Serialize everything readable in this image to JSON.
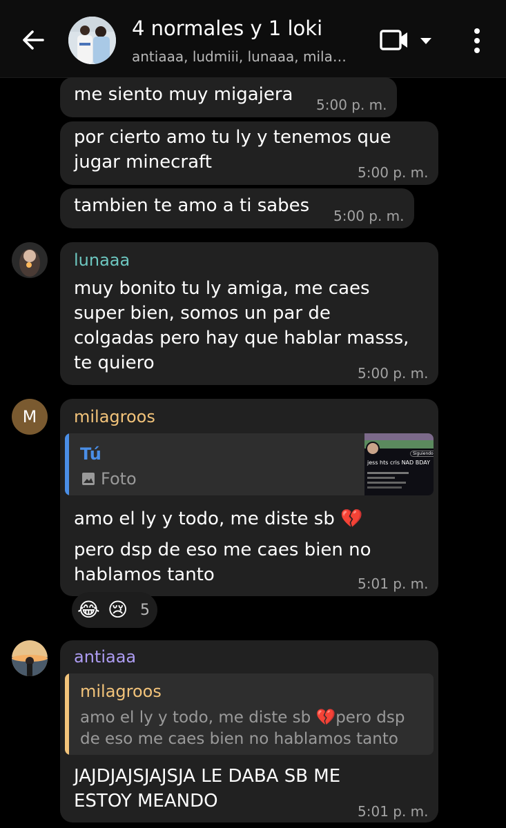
{
  "header": {
    "back_icon": "arrow-left-icon",
    "title": "4 normales y 1 loki",
    "subtitle": "antiaaa, ludmiii, lunaaa, mila…",
    "video_icon": "video-camera-icon",
    "more_icon": "more-vert-icon"
  },
  "messages": {
    "m1": {
      "text": "me siento muy migajera",
      "time": "5:00 p. m."
    },
    "m2": {
      "lines": [
        "por cierto amo tu ly y tenemos que",
        "jugar minecraft"
      ],
      "time": "5:00 p. m."
    },
    "m3": {
      "text": "tambien te amo a ti sabes",
      "time": "5:00 p. m."
    },
    "m4": {
      "sender": "lunaaa",
      "lines": [
        "muy bonito tu ly amiga, me caes",
        "super bien, somos un par de",
        "colgadas pero hay que hablar masss,",
        "te quiero"
      ],
      "time": "5:00 p. m."
    },
    "m5": {
      "sender": "milagroos",
      "avatar_letter": "M",
      "reply": {
        "author": "Tú",
        "type": "Foto",
        "thumb": {
          "title": "jess hts cris NAD BDAY",
          "button": "Siguiendo"
        }
      },
      "lines": [
        "amo el ly y todo, me diste sb 💔",
        "pero dsp de eso me caes bien no",
        "hablamos tanto"
      ],
      "time": "5:01 p. m.",
      "reactions": {
        "emoji1": "😂",
        "emoji2": "😢",
        "count": "5"
      }
    },
    "m6": {
      "sender": "antiaaa",
      "reply": {
        "author": "milagroos",
        "lines": [
          "amo el ly y todo, me diste sb 💔pero dsp",
          "de eso me caes bien no hablamos tanto"
        ]
      },
      "lines": [
        "JAJDJAJSJAJSJA LE DABA SB ME",
        "ESTOY MEANDO"
      ],
      "time": "5:01 p. m."
    }
  },
  "colors": {
    "lunaaa": "#6dc7c0",
    "milagroos": "#f2c37a",
    "antiaaa": "#ad9cf2",
    "reply_tu": "#4a8ee6",
    "reply_milagroos": "#f2c37a",
    "avatar_m": "#7a5a30"
  }
}
